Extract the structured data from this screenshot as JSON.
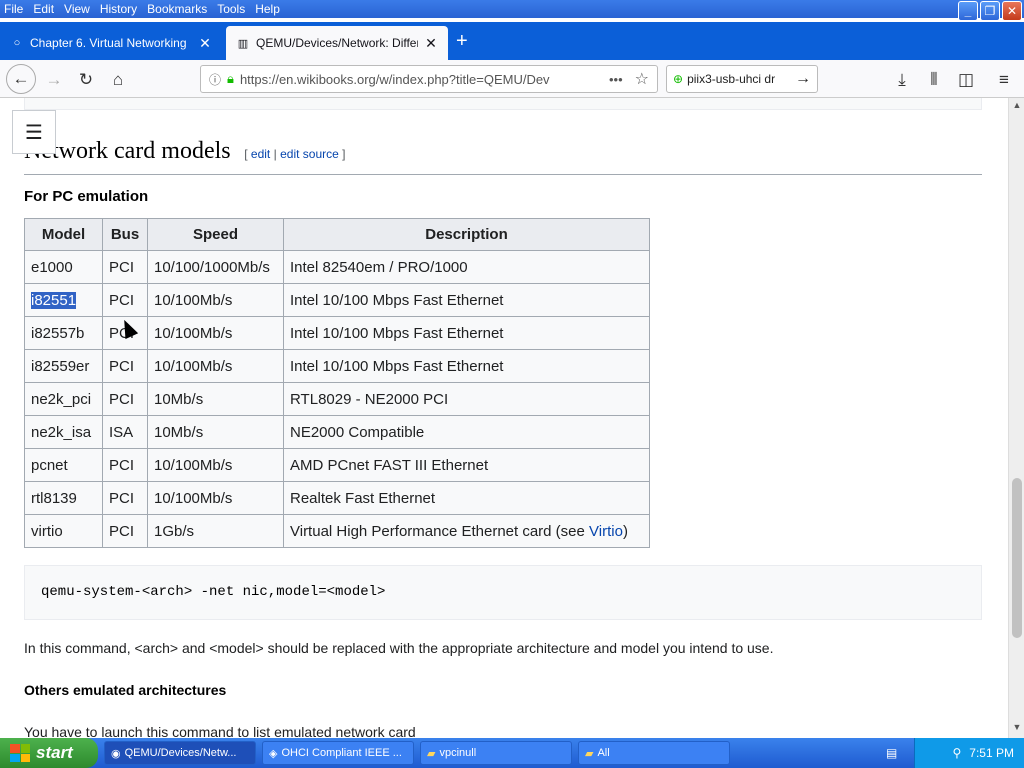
{
  "menu": [
    "File",
    "Edit",
    "View",
    "History",
    "Bookmarks",
    "Tools",
    "Help"
  ],
  "tabs": [
    {
      "title": "Chapter 6. Virtual Networking"
    },
    {
      "title": "QEMU/Devices/Network: Differen"
    }
  ],
  "url": "https://en.wikibooks.org/w/index.php?title=QEMU/Dev",
  "search_value": "piix3-usb-uhci dr",
  "page": {
    "heading": "Network card models",
    "edit_open": "[",
    "edit": "edit",
    "sep": "|",
    "edit_source": "edit source",
    "edit_close": "]",
    "subheading": "For PC emulation",
    "table": {
      "headers": [
        "Model",
        "Bus",
        "Speed",
        "Description"
      ],
      "rows": [
        [
          "e1000",
          "PCI",
          "10/100/1000Mb/s",
          "Intel 82540em / PRO/1000"
        ],
        [
          "i82551",
          "PCI",
          "10/100Mb/s",
          "Intel 10/100 Mbps Fast Ethernet"
        ],
        [
          "i82557b",
          "PCI",
          "10/100Mb/s",
          "Intel 10/100 Mbps Fast Ethernet"
        ],
        [
          "i82559er",
          "PCI",
          "10/100Mb/s",
          "Intel 10/100 Mbps Fast Ethernet"
        ],
        [
          "ne2k_pci",
          "PCI",
          "10Mb/s",
          "RTL8029 - NE2000 PCI"
        ],
        [
          "ne2k_isa",
          "ISA",
          "10Mb/s",
          "NE2000 Compatible"
        ],
        [
          "pcnet",
          "PCI",
          "10/100Mb/s",
          "AMD PCnet FAST III Ethernet"
        ],
        [
          "rtl8139",
          "PCI",
          "10/100Mb/s",
          "Realtek Fast Ethernet"
        ],
        [
          "virtio",
          "PCI",
          "1Gb/s",
          "Virtual High Performance Ethernet card (see "
        ]
      ],
      "virtio_link": "Virtio",
      "virtio_close": ")"
    },
    "code": "qemu-system-<arch> -net nic,model=<model>",
    "para": "In this command, <arch> and <model> should be replaced with the appropriate architecture and model you intend to use.",
    "subheading2": "Others emulated architectures",
    "para2": "You have to launch this command to list emulated network card"
  },
  "taskbar": {
    "start": "start",
    "items": [
      "QEMU/Devices/Netw...",
      "OHCI Compliant IEEE ...",
      "vpcinull",
      "All"
    ],
    "clock": "7:51 PM"
  }
}
